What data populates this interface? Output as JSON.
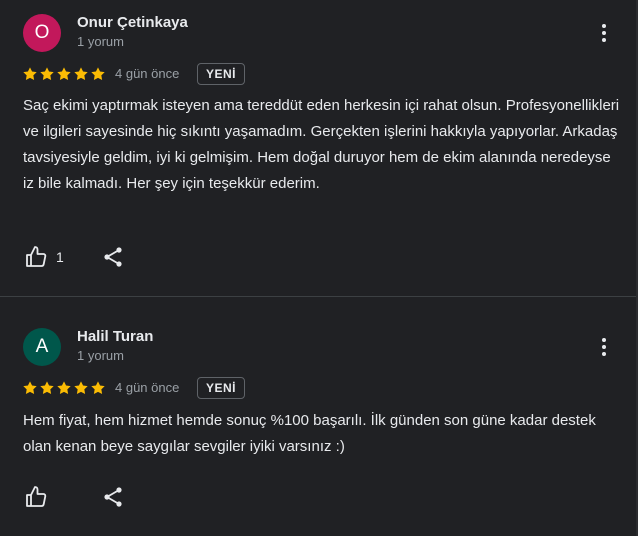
{
  "reviews": [
    {
      "avatar_letter": "O",
      "avatar_color": "#c2185b",
      "name": "Onur Çetinkaya",
      "subtitle": "1 yorum",
      "rating": 5,
      "time": "4 gün önce",
      "badge": "YENİ",
      "text": "Saç ekimi yaptırmak isteyen ama tereddüt eden herkesin içi rahat olsun. Profesyonellikleri ve ilgileri sayesinde hiç sıkıntı yaşamadım. Gerçekten işlerini hakkıyla yapıyorlar. Arkadaş tavsiyesiyle geldim, iyi ki gelmişim. Hem doğal duruyor hem de ekim alanında neredeyse iz bile kalmadı. Her şey için teşekkür ederim.",
      "likes": "1"
    },
    {
      "avatar_letter": "A",
      "avatar_color": "#00574b",
      "name": "Halil Turan",
      "subtitle": "1 yorum",
      "rating": 5,
      "time": "4 gün önce",
      "badge": "YENİ",
      "text": "Hem fiyat, hem hizmet hemde sonuç %100 başarılı. İlk günden son güne kadar destek olan kenan beye saygılar sevgiler iyiki varsınız :)",
      "likes": ""
    }
  ],
  "colors": {
    "star": "#fbbc04",
    "background": "#202124"
  },
  "icons": {
    "like": "thumb-up-icon",
    "share": "share-icon",
    "menu": "more-vert-icon",
    "star": "star-icon"
  }
}
